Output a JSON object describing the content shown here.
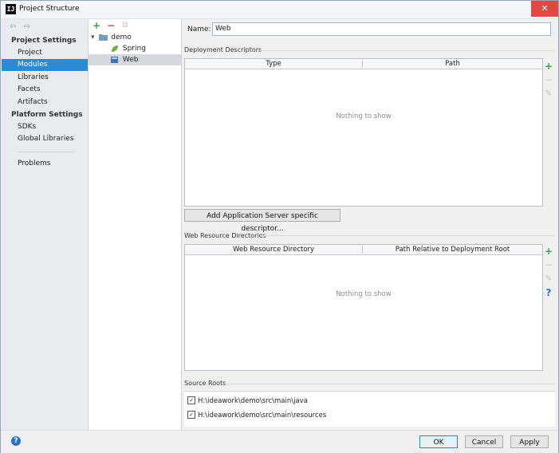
{
  "window": {
    "app_icon": "IJ",
    "title": "Project Structure",
    "close_glyph": "✕"
  },
  "nav": {
    "back_glyph": "⇦",
    "forward_glyph": "⇨",
    "project_settings_header": "Project Settings",
    "platform_settings_header": "Platform Settings",
    "items": [
      "Project",
      "Modules",
      "Libraries",
      "Facets",
      "Artifacts",
      "SDKs",
      "Global Libraries",
      "Problems"
    ],
    "selected": "Modules"
  },
  "module_tree": {
    "add_glyph": "+",
    "remove_glyph": "−",
    "copy_glyph": "⧉",
    "expand_glyph": "▾",
    "module": "demo",
    "children": [
      "Spring",
      "Web"
    ],
    "selected": "Web",
    "icons": {
      "module": "folder-icon",
      "spring": "spring-leaf-icon",
      "web": "web-facet-icon"
    }
  },
  "facet": {
    "name_label": "Name:",
    "name_value": "Web",
    "deployment": {
      "title": "Deployment Descriptors",
      "columns": [
        "Type",
        "Path"
      ],
      "empty_text": "Nothing to show",
      "add_button": "Add Application Server specific descriptor..."
    },
    "resources": {
      "title": "Web Resource Directories",
      "columns": [
        "Web Resource Directory",
        "Path Relative to Deployment Root"
      ],
      "empty_text": "Nothing to show"
    },
    "tools": {
      "add": "+",
      "remove": "−",
      "edit": "✎",
      "help": "?"
    },
    "source_roots": {
      "title": "Source Roots",
      "check_glyph": "✓",
      "items": [
        {
          "path": "H:\\ideawork\\demo\\src\\main\\java",
          "checked": true
        },
        {
          "path": "H:\\ideawork\\demo\\src\\main\\resources",
          "checked": true
        }
      ]
    }
  },
  "footer": {
    "help": "?",
    "ok": "OK",
    "cancel": "Cancel",
    "apply": "Apply"
  },
  "colors": {
    "selection": "#2a8ad4",
    "add_green": "#3fa14a",
    "remove_red": "#d9403a",
    "close_red": "#e2483f",
    "help_blue": "#2a73c4"
  }
}
